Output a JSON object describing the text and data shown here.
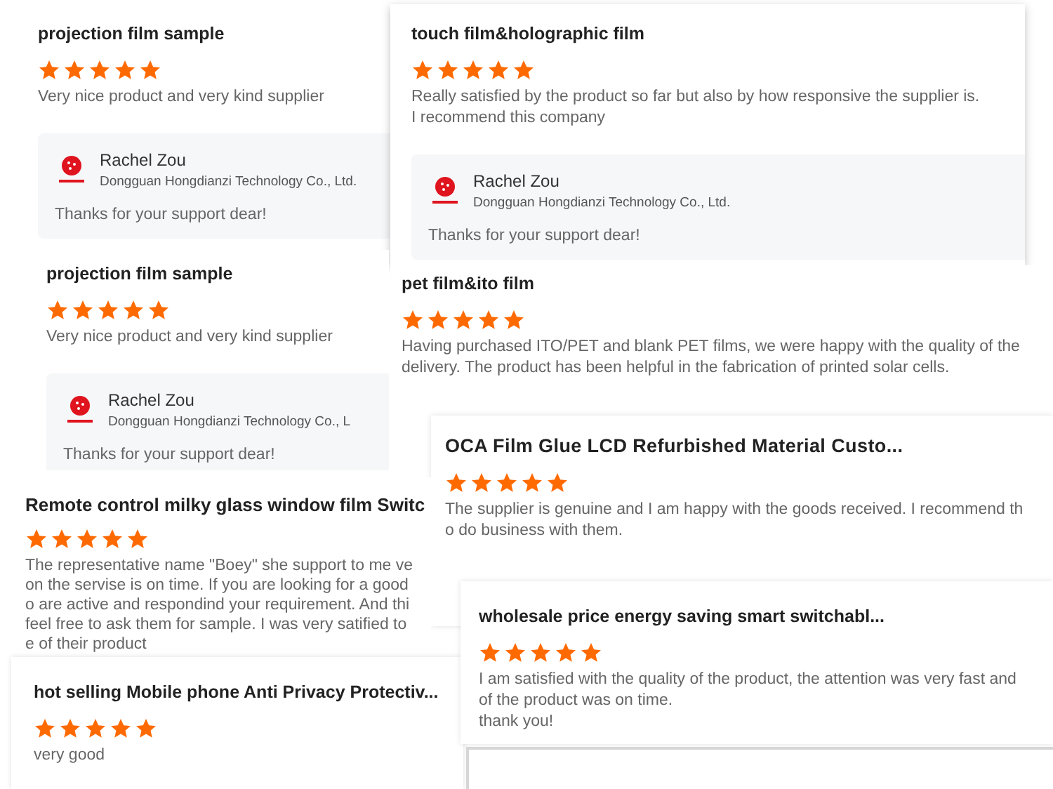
{
  "cards": [
    {
      "title": "projection film sample",
      "stars": 5,
      "body": [
        "Very nice product and very kind supplier"
      ],
      "reply": {
        "name": "Rachel Zou",
        "company": "Dongguan Hongdianzi Technology Co., Ltd.",
        "message": "Thanks for your support dear!"
      }
    },
    {
      "title": "touch film&holographic film",
      "stars": 5,
      "body": [
        "Really satisfied by the product so far but also by how responsive the supplier is.",
        "I recommend this company"
      ],
      "reply": {
        "name": "Rachel Zou",
        "company": "Dongguan Hongdianzi Technology Co., Ltd.",
        "message": "Thanks for your support dear!"
      }
    },
    {
      "title": "projection film sample",
      "stars": 5,
      "body": [
        "Very nice product and very kind supplier"
      ],
      "reply": {
        "name": "Rachel Zou",
        "company": "Dongguan Hongdianzi Technology Co., L",
        "message": "Thanks for your support dear!"
      }
    },
    {
      "title": "pet film&ito film",
      "stars": 5,
      "body": [
        "Having purchased ITO/PET and blank PET films, we were happy with the quality of the",
        "delivery. The product has been helpful in the fabrication of printed solar cells."
      ]
    },
    {
      "title": "OCA Film Glue LCD Refurbished Material Custo...",
      "stars": 5,
      "body": [
        "The supplier is genuine and I am happy with the goods received. I recommend th",
        "o do business with them."
      ]
    },
    {
      "title": "Remote control milky glass window film Switc",
      "stars": 5,
      "body": [
        "The representative name \"Boey\" she support to me ve",
        "on the servise is on time. If you are looking for a good",
        "o are active and respondind your requirement. And thi",
        "feel free to ask them for sample. I was very satified to",
        "e of their product"
      ]
    },
    {
      "title": "hot selling Mobile phone Anti Privacy Protectiv...",
      "stars": 5,
      "body": [
        "very good"
      ]
    },
    {
      "title": "wholesale price energy saving smart switchabl...",
      "stars": 5,
      "body": [
        "I am satisfied with the quality of the product, the attention was very fast and",
        "of the product was on time.",
        "thank you!"
      ]
    }
  ]
}
